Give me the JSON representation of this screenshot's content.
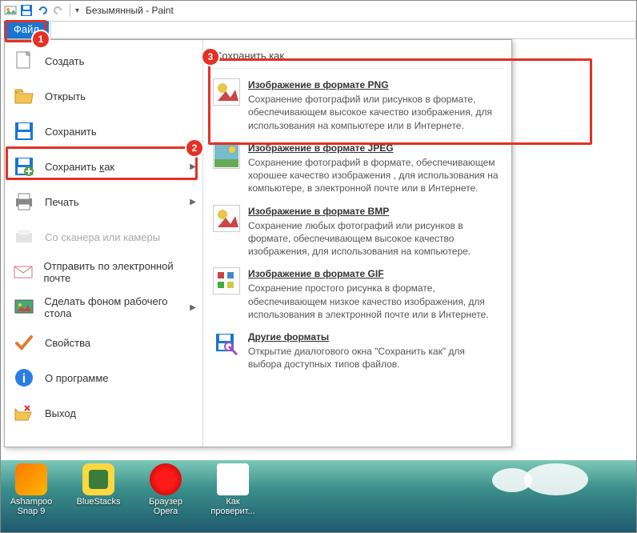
{
  "window": {
    "title": "Безымянный - Paint"
  },
  "ribbon": {
    "file_tab": "Файл"
  },
  "file_menu": {
    "items": [
      {
        "label": "Создать"
      },
      {
        "label": "Открыть"
      },
      {
        "label": "Сохранить"
      },
      {
        "label": "Сохранить как",
        "submenu": true,
        "u": "к"
      },
      {
        "label": "Печать",
        "submenu": true
      },
      {
        "label": "Со сканера или камеры",
        "disabled": true
      },
      {
        "label": "Отправить по электронной почте"
      },
      {
        "label": "Сделать фоном рабочего стола",
        "submenu": true
      },
      {
        "label": "Свойства"
      },
      {
        "label": "О программе"
      },
      {
        "label": "Выход"
      }
    ]
  },
  "submenu": {
    "header": "Сохранить как",
    "formats": [
      {
        "title": "Изображение в формате PNG",
        "desc": "Сохранение фотографий или рисунков в формате, обеспечивающем высокое качество изображения, для использования на компьютере или в Интернете."
      },
      {
        "title": "Изображение в формате JPEG",
        "desc": "Сохранение фотографий в формате, обеспечивающем хорошее качество изображения , для использования на компьютере, в электронной почте или в Интернете."
      },
      {
        "title": "Изображение в формате BMP",
        "desc": "Сохранение любых фотографий или рисунков в формате, обеспечивающем высокое качество изображения, для использования на компьютере."
      },
      {
        "title": "Изображение в формате GIF",
        "desc": "Сохранение простого рисунка в формате, обеспечивающем низкое качество изображения, для использования в электронной почте или в Интернете."
      },
      {
        "title": "Другие форматы",
        "desc": "Открытие диалогового окна \"Сохранить как\" для выбора доступных типов файлов."
      }
    ]
  },
  "annotations": {
    "b1": "1",
    "b2": "2",
    "b3": "3"
  },
  "desktop": {
    "icons": [
      {
        "label": "Ashampoo Snap 9"
      },
      {
        "label": "BlueStacks"
      },
      {
        "label": "Браузер Opera"
      },
      {
        "label": "Как проверит..."
      }
    ]
  }
}
